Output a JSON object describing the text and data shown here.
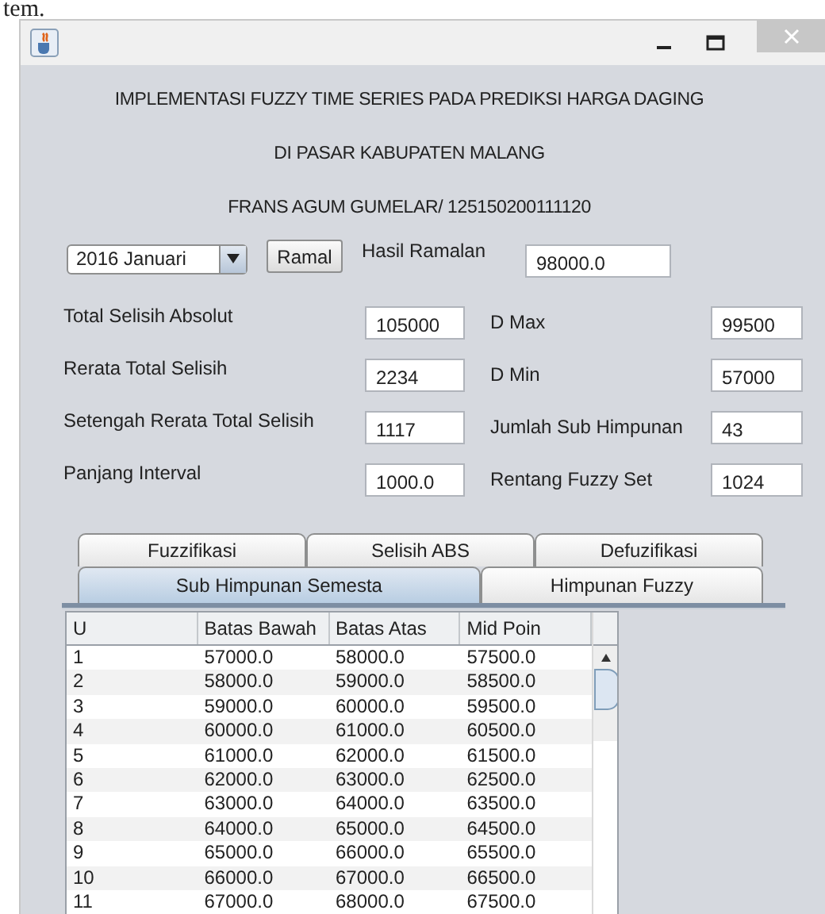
{
  "document_fragment": "tem.",
  "header_lines": [
    "IMPLEMENTASI FUZZY TIME SERIES PADA PREDIKSI HARGA DAGING",
    "DI PASAR KABUPATEN MALANG",
    "FRANS AGUM GUMELAR/ 125150200111120"
  ],
  "forecast": {
    "period": "2016 Januari",
    "button": "Ramal",
    "result_label": "Hasil Ramalan",
    "result_value": "98000.0"
  },
  "field_rows": [
    {
      "left": {
        "label": "Total Selisih Absolut",
        "value": "105000"
      },
      "right": {
        "label": "D Max",
        "value": "99500"
      }
    },
    {
      "left": {
        "label": "Rerata Total Selisih",
        "value": "2234"
      },
      "right": {
        "label": "D Min",
        "value": "57000"
      }
    },
    {
      "left": {
        "label": "Setengah Rerata Total Selisih",
        "value": "1117"
      },
      "right": {
        "label": "Jumlah Sub Himpunan",
        "value": "43"
      }
    },
    {
      "left": {
        "label": "Panjang Interval",
        "value": "1000.0"
      },
      "right": {
        "label": "Rentang Fuzzy Set",
        "value": "1024"
      }
    }
  ],
  "tab_rows": [
    [
      {
        "label": "Fuzzifikasi",
        "selected": false
      },
      {
        "label": "Selisih ABS",
        "selected": false
      },
      {
        "label": "Defuzifikasi",
        "selected": false
      }
    ],
    [
      {
        "label": "Sub Himpunan Semesta",
        "selected": true
      },
      {
        "label": "Himpunan Fuzzy",
        "selected": false
      }
    ]
  ],
  "table": {
    "columns": [
      "U",
      "Batas Bawah",
      "Batas Atas",
      "Mid Poin"
    ],
    "rows": [
      [
        "1",
        "57000.0",
        "58000.0",
        "57500.0"
      ],
      [
        "2",
        "58000.0",
        "59000.0",
        "58500.0"
      ],
      [
        "3",
        "59000.0",
        "60000.0",
        "59500.0"
      ],
      [
        "4",
        "60000.0",
        "61000.0",
        "60500.0"
      ],
      [
        "5",
        "61000.0",
        "62000.0",
        "61500.0"
      ],
      [
        "6",
        "62000.0",
        "63000.0",
        "62500.0"
      ],
      [
        "7",
        "63000.0",
        "64000.0",
        "63500.0"
      ],
      [
        "8",
        "64000.0",
        "65000.0",
        "64500.0"
      ],
      [
        "9",
        "65000.0",
        "66000.0",
        "65500.0"
      ],
      [
        "10",
        "66000.0",
        "67000.0",
        "66500.0"
      ],
      [
        "11",
        "67000.0",
        "68000.0",
        "67500.0"
      ]
    ]
  }
}
